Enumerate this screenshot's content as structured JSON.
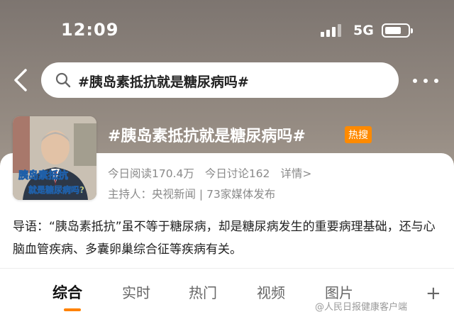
{
  "status_bar": {
    "time": "12:09",
    "network": "5G"
  },
  "search": {
    "query": "#胰岛素抵抗就是糖尿病吗#"
  },
  "topic": {
    "title": "#胰岛素抵抗就是糖尿病吗#",
    "hot_badge": "热搜",
    "thumbnail_caption_line1": "胰岛素抵抗",
    "thumbnail_caption_line2": "就是糖尿病吗?",
    "reads": "今日阅读170.4万",
    "discussions": "今日讨论162",
    "details_link": "详情>",
    "host": "主持人：央视新闻 | 73家媒体发布"
  },
  "intro": "导语：“胰岛素抵抗”虽不等于糖尿病，却是糖尿病发生的重要病理基础，还与心脑血管疾病、多囊卵巢综合征等疾病有关。",
  "tabs": [
    "综合",
    "实时",
    "热门",
    "视频",
    "图片"
  ],
  "tab_plus": "+",
  "watermark": "@人民日报健康客户端",
  "colors": {
    "accent": "#ff8200",
    "hot_badge": "#ff8a00"
  }
}
